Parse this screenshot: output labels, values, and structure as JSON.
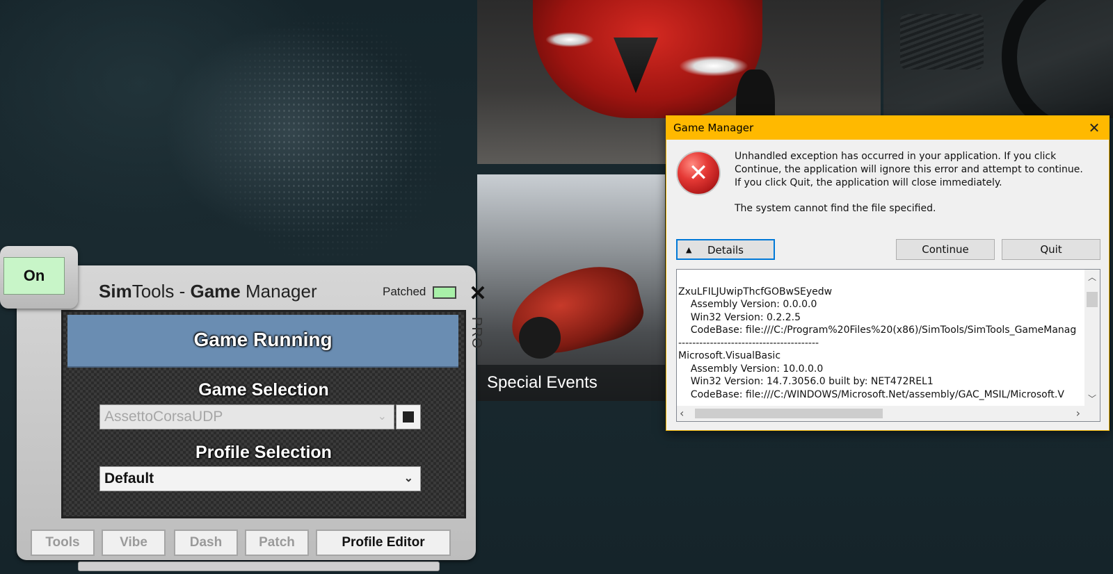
{
  "background": {
    "tile_caption": "Special Events"
  },
  "simtools": {
    "on_label": "On",
    "title_part1_bold": "Sim",
    "title_part2": "Tools - ",
    "title_part3_bold": "Game",
    "title_part4": " Manager",
    "patched_label": "Patched",
    "close_glyph": "✕",
    "pro_label": "PRO",
    "status": "Game Running",
    "game_selection_heading": "Game Selection",
    "game_selection_value": "AssettoCorsaUDP",
    "profile_selection_heading": "Profile Selection",
    "profile_selection_value": "Default",
    "buttons": {
      "tools": "Tools",
      "vibe": "Vibe",
      "dash": "Dash",
      "patch": "Patch",
      "profile_editor": "Profile Editor"
    },
    "colors": {
      "status_bg": "#6a8db2",
      "on_bg": "#c8f5c8",
      "patched_led": "#a8f0a8"
    }
  },
  "dialog": {
    "title": "Game Manager",
    "close_glyph": "✕",
    "icon": "error-icon",
    "message": "Unhandled exception has occurred in your application. If you click Continue, the application will ignore this error and attempt to continue. If you click Quit, the application will close immediately.",
    "message2": "The system cannot find the file specified.",
    "details_label": "Details",
    "continue_label": "Continue",
    "quit_label": "Quit",
    "details_lines": [
      "ZxuLFILJUwipThcfGOBwSEyedw",
      "    Assembly Version: 0.0.0.0",
      "    Win32 Version: 0.2.2.5",
      "    CodeBase: file:///C:/Program%20Files%20(x86)/SimTools/SimTools_GameManag",
      "----------------------------------------",
      "Microsoft.VisualBasic",
      "    Assembly Version: 10.0.0.0",
      "    Win32 Version: 14.7.3056.0 built by: NET472REL1",
      "    CodeBase: file:///C:/WINDOWS/Microsoft.Net/assembly/GAC_MSIL/Microsoft.V",
      "----------------------------------------"
    ],
    "colors": {
      "titlebar": "#ffb900"
    }
  }
}
